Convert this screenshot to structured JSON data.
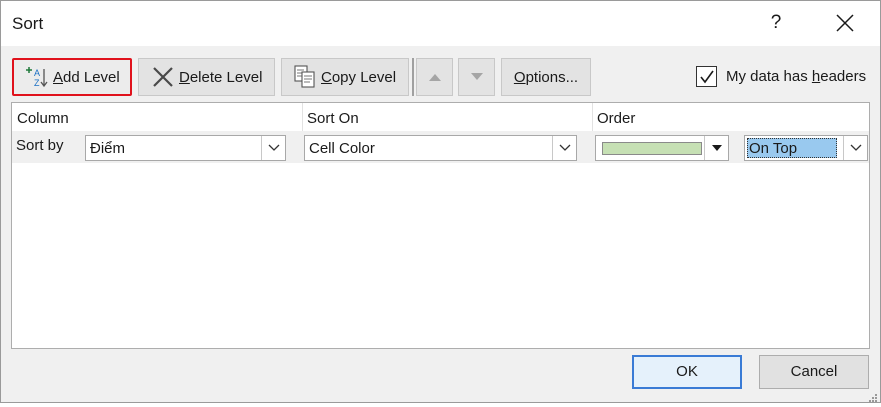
{
  "window": {
    "title": "Sort",
    "help_label": "?"
  },
  "toolbar": {
    "add_level": {
      "prefix": "",
      "accel": "A",
      "rest": "dd Level"
    },
    "delete_level": {
      "accel": "D",
      "rest": "elete Level"
    },
    "copy_level": {
      "accel": "C",
      "rest": "opy Level"
    },
    "options": {
      "accel": "O",
      "rest": "ptions..."
    }
  },
  "headers_checkbox": {
    "checked": true,
    "label_pre": "My data has ",
    "accel": "h",
    "label_post": "eaders"
  },
  "grid": {
    "columns": [
      "Column",
      "Sort On",
      "Order"
    ],
    "rows": [
      {
        "label": "Sort by",
        "column": "Điểm",
        "sort_on": "Cell Color",
        "order_color": "#c6e0b4",
        "position": "On Top"
      }
    ]
  },
  "buttons": {
    "ok": "OK",
    "cancel": "Cancel"
  },
  "colors": {
    "highlight": "#e0121c",
    "selection": "#99c9ef",
    "default_button": "#3a7bd5"
  }
}
